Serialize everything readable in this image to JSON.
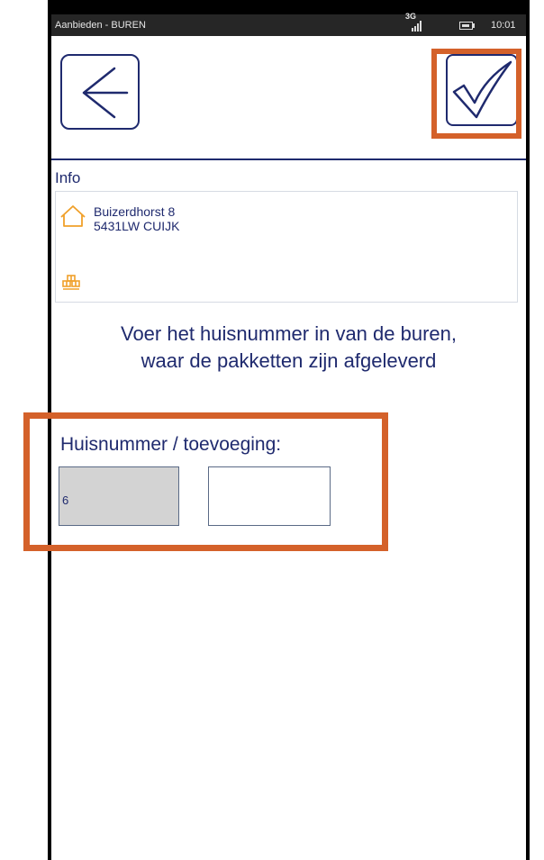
{
  "status_bar": {
    "title": "Aanbieden - BUREN",
    "network": "3G",
    "time": "10:01"
  },
  "toolbar": {
    "back_icon": "arrow-left-icon",
    "confirm_icon": "checkmark-icon"
  },
  "info": {
    "heading": "Info",
    "address_line1": "Buizerdhorst 8",
    "address_line2": "5431LW CUIJK",
    "address_icon": "house-icon",
    "parcels_icon": "parcels-icon"
  },
  "instruction": {
    "line1": "Voer het huisnummer in van de buren,",
    "line2": "waar de pakketten zijn afgeleverd"
  },
  "form": {
    "label": "Huisnummer / toevoeging:",
    "house_number": "6",
    "addition": ""
  },
  "colors": {
    "accent": "#1f2a6e",
    "highlight": "#d4612a",
    "icon_orange": "#f0a02a"
  }
}
